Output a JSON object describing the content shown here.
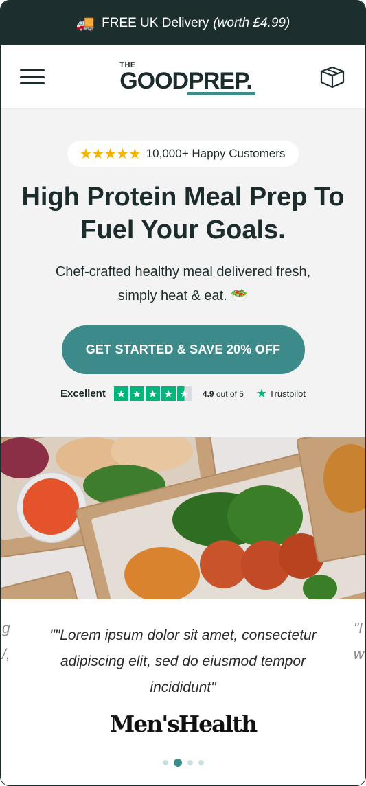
{
  "promo": {
    "truck_icon": "delivery-truck-icon",
    "text": "FREE UK Delivery",
    "note": "(worth £4.99)"
  },
  "header": {
    "logo_the": "THE",
    "logo_word": "GOODPREP.",
    "menu_icon": "hamburger-icon",
    "box_icon": "box-icon"
  },
  "hero": {
    "rating_text": "10,000+ Happy Customers",
    "stars": "★★★★★",
    "headline": "High Protein Meal Prep To Fuel Your Goals.",
    "subheading": "Chef-crafted healthy meal delivered fresh, simply heat & eat. 🥗",
    "cta_label": "GET STARTED & SAVE 20% OFF",
    "trustpilot": {
      "label": "Excellent",
      "score_prefix": "4.9",
      "score_suffix": "out of 5",
      "brand": "Trustpilot",
      "rating": 4.5
    }
  },
  "testimonial": {
    "quote": "\"\"Lorem ipsum dolor sit amet, consectetur adipiscing elit, sed do eiusmod tempor incididunt\"",
    "brand": "Men'sHealth",
    "peek_left": "g\n/,",
    "peek_right": "\"I\nw",
    "slides": 4,
    "active_slide": 2
  },
  "colors": {
    "dark": "#1c2e2e",
    "teal": "#3c8a8a",
    "hero_bg": "#f3f3f3",
    "star": "#f5b400",
    "trustpilot_green": "#00b67a"
  }
}
